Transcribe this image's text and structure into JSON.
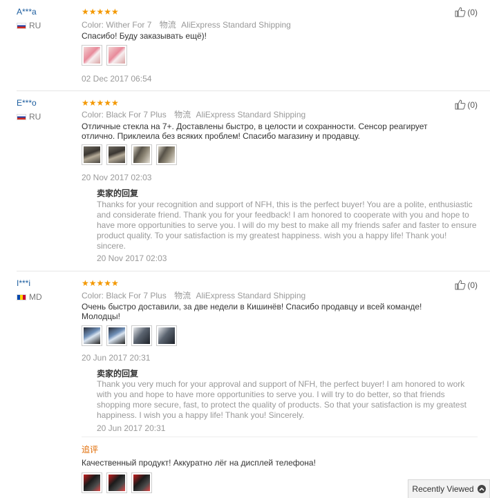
{
  "labels": {
    "color": "Color:",
    "shipping": "物流",
    "seller_reply_title": "卖家的回复",
    "additional_review": "追评"
  },
  "reviews": [
    {
      "user": "A***a",
      "country": "RU",
      "stars": "★★★★★",
      "color": "Wither For 7",
      "shipping": "AliExpress Standard Shipping",
      "feedback": "Спасибо! Буду заказывать ещё)!",
      "date": "02 Dec 2017 06:54",
      "likes": "(0)"
    },
    {
      "user": "E***o",
      "country": "RU",
      "stars": "★★★★★",
      "color": "Black For 7 Plus",
      "shipping": "AliExpress Standard Shipping",
      "feedback": "Отличные стекла на 7+. Доставлены быстро, в целости и сохранности. Сенсор реагирует отлично. Приклеила без всяких проблем! Спасибо магазину и продавцу.",
      "date": "20 Nov 2017 02:03",
      "likes": "(0)",
      "reply": "Thanks for your recognition and support of NFH, this is the perfect buyer! You are a polite, enthusiastic and considerate friend. Thank you for your feedback! I am honored to cooperate with you and hope to have more opportunities to serve you. I will do my best to make all my friends safer and faster to ensure product quality. To your satisfaction is my greatest happiness. wish you a happy life! Thank you! sincere.",
      "reply_date": "20 Nov 2017 02:03"
    },
    {
      "user": "I***i",
      "country": "MD",
      "stars": "★★★★★",
      "color": "Black For 7 Plus",
      "shipping": "AliExpress Standard Shipping",
      "feedback": "Очень быстро доставили, за две недели в Кишинёв! Спасибо продавцу и всей команде! Молодцы!",
      "date": "20 Jun 2017 20:31",
      "likes": "(0)",
      "reply": "Thank you very much for your approval and support of NFH, the perfect buyer! I am honored to work with you and hope to have more opportunities to serve you. I will try to do better, so that friends shopping more secure, fast, to protect the quality of products. So that your satisfaction is my greatest happiness. I wish you a happy life! Thank you! Sincerely.",
      "reply_date": "20 Jun 2017 20:31",
      "additional_feedback": "Качественный продукт! Аккуратно лёг на дисплей телефона!"
    }
  ],
  "recently_viewed": "Recently Viewed"
}
